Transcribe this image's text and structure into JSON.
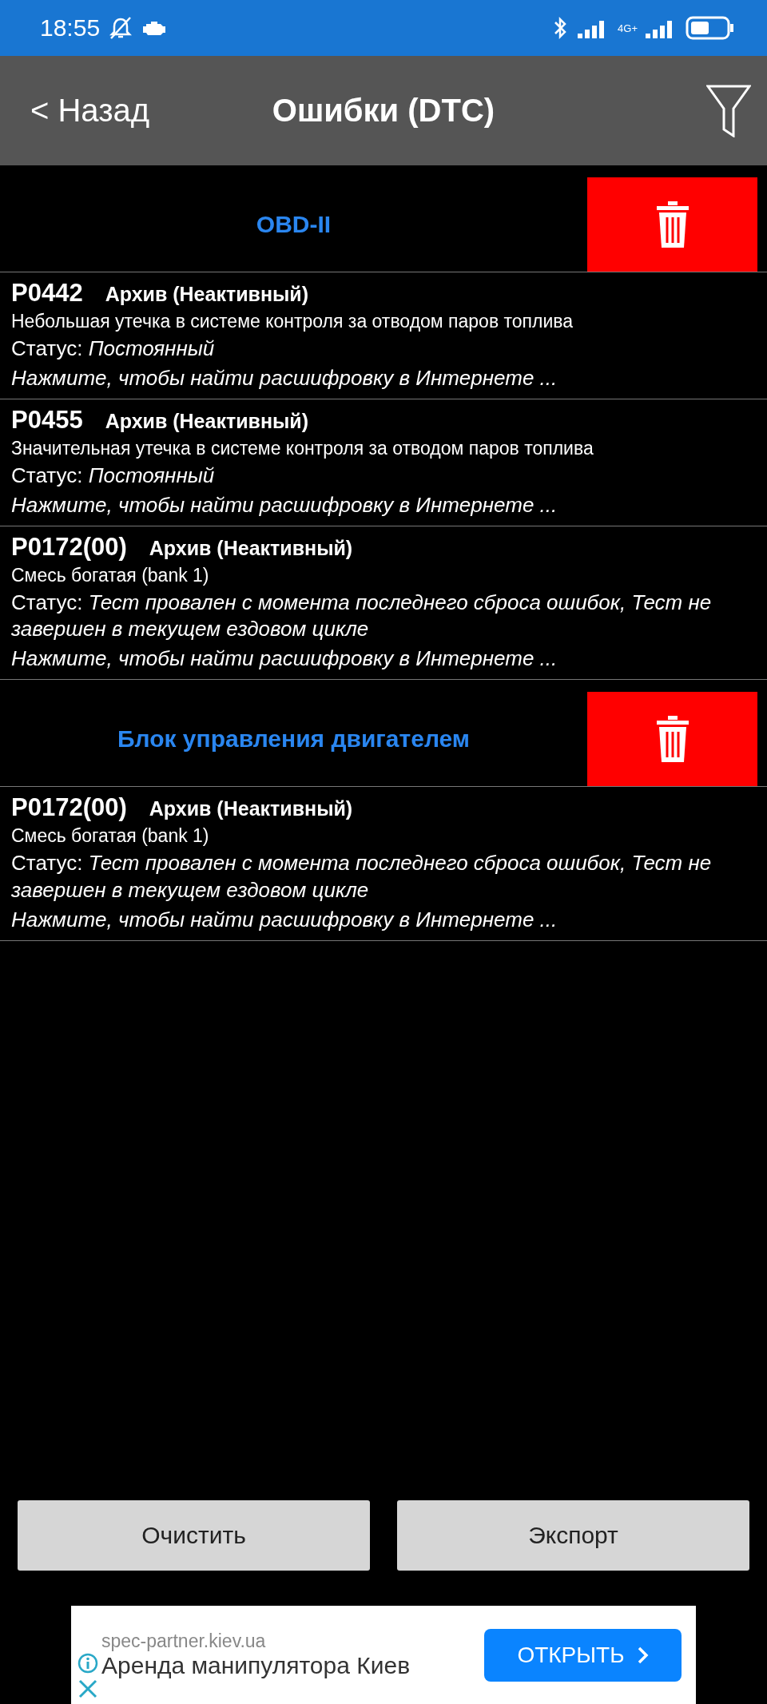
{
  "status_bar": {
    "time": "18:55",
    "network": "4G+"
  },
  "header": {
    "back": "< Назад",
    "title": "Ошибки (DTC)"
  },
  "sections": [
    {
      "title": "OBD-II",
      "errors": [
        {
          "code": "P0442",
          "state": "Архив (Неактивный)",
          "description": "Небольшая утечка в системе контроля за отводом паров топлива",
          "status": "Статус: *Постоянный*",
          "hint": "Нажмите, чтобы найти расшифровку в Интернете ..."
        },
        {
          "code": "P0455",
          "state": "Архив (Неактивный)",
          "description": "Значительная утечка в системе контроля за отводом паров топлива",
          "status": "Статус: *Постоянный*",
          "hint": "Нажмите, чтобы найти расшифровку в Интернете ..."
        },
        {
          "code": "P0172(00)",
          "state": "Архив (Неактивный)",
          "description": "Смесь богатая (bank 1)",
          "status": "Статус: *Тест провален с момента последнего сброса ошибок, Тест не завершен в текущем ездовом цикле*",
          "hint": "Нажмите, чтобы найти расшифровку в Интернете ..."
        }
      ]
    },
    {
      "title": "Блок управления двигателем",
      "errors": [
        {
          "code": "P0172(00)",
          "state": "Архив (Неактивный)",
          "description": "Смесь богатая (bank 1)",
          "status": "Статус: *Тест провален с момента последнего сброса ошибок, Тест не завершен в текущем ездовом цикле*",
          "hint": "Нажмите, чтобы найти расшифровку в Интернете ..."
        }
      ]
    }
  ],
  "buttons": [
    "Очистить",
    "Экспорт"
  ],
  "ad": {
    "domain": "spec-partner.kiev.ua",
    "headline": "Аренда манипулятора Киев",
    "action": "ОТКРЫТЬ"
  }
}
